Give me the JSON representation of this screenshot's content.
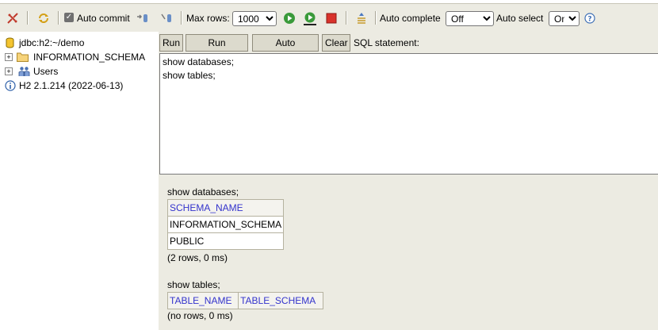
{
  "toolbar": {
    "icons": [
      "disconnect-icon",
      "refresh-icon",
      "commit-icon",
      "rollback-icon",
      "run-icon",
      "run-selected-icon",
      "stop-icon",
      "history-icon",
      "help-icon"
    ],
    "auto_commit_label": "Auto commit",
    "auto_commit_checked": true,
    "max_rows_label": "Max rows:",
    "max_rows_value": "1000",
    "auto_complete_label": "Auto complete",
    "auto_complete_value": "Off",
    "auto_select_label": "Auto select",
    "auto_select_value": "On"
  },
  "tree": {
    "connection": "jdbc:h2:~/demo",
    "items": [
      {
        "label": "INFORMATION_SCHEMA",
        "icon": "folder-icon"
      },
      {
        "label": "Users",
        "icon": "users-icon"
      }
    ],
    "version": "H2 2.1.214 (2022-06-13)"
  },
  "query": {
    "buttons": {
      "run": "Run",
      "run_selected": "Run Selected",
      "auto_complete": "Auto complete",
      "clear": "Clear"
    },
    "sql_label": "SQL statement:",
    "sql_text": "show databases;\nshow tables;"
  },
  "results": [
    {
      "statement": "show databases;",
      "columns": [
        "SCHEMA_NAME"
      ],
      "rows": [
        [
          "INFORMATION_SCHEMA"
        ],
        [
          "PUBLIC"
        ]
      ],
      "summary": "(2 rows, 0 ms)"
    },
    {
      "statement": "show tables;",
      "columns": [
        "TABLE_NAME",
        "TABLE_SCHEMA"
      ],
      "rows": [],
      "summary": "(no rows, 0 ms)"
    }
  ],
  "colors": {
    "toolbar_bg": "#ecebe2",
    "header_text": "#3333cc",
    "run_green": "#2e8b2e",
    "stop_red": "#d9322b"
  }
}
